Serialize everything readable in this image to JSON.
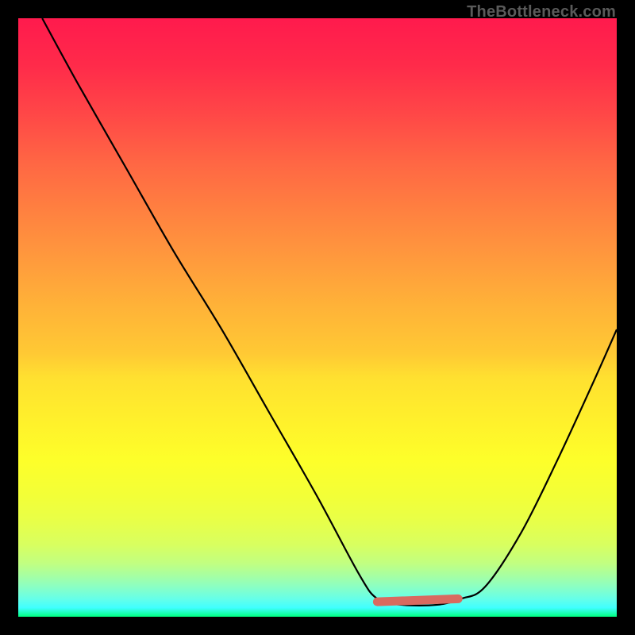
{
  "watermark": "TheBottleneck.com",
  "chart_data": {
    "type": "line",
    "title": "",
    "xlabel": "",
    "ylabel": "",
    "xlim": [
      0,
      100
    ],
    "ylim": [
      0,
      100
    ],
    "series": [
      {
        "name": "bottleneck-curve",
        "x": [
          4,
          10,
          18,
          26,
          34,
          42,
          50,
          57,
          60,
          64,
          70,
          74,
          78,
          84,
          90,
          96,
          100
        ],
        "values": [
          100,
          89,
          75,
          61,
          48,
          34,
          20,
          7,
          3,
          2,
          2,
          3,
          5,
          14,
          26,
          39,
          48
        ]
      }
    ],
    "marker": {
      "name": "optimal-range",
      "x": [
        60,
        73.5
      ],
      "y": [
        2.5,
        3
      ],
      "left_dot_radius_px": 5
    },
    "gradient_stops": [
      {
        "pos": 0,
        "color": "#ff1a4d"
      },
      {
        "pos": 0.5,
        "color": "#ffd030"
      },
      {
        "pos": 0.9,
        "color": "#d8ff60"
      },
      {
        "pos": 1.0,
        "color": "#00ff80"
      }
    ]
  }
}
